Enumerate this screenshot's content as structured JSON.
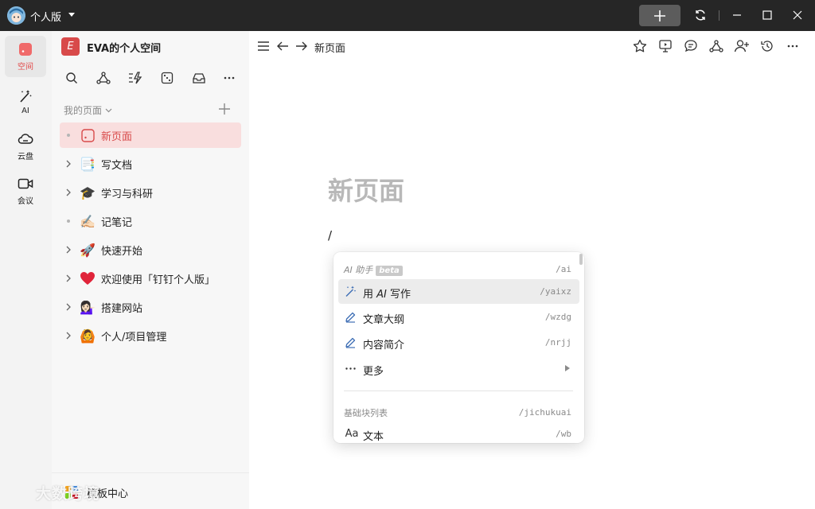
{
  "titlebar": {
    "app_title": "个人版"
  },
  "rail": {
    "items": [
      {
        "label": "空间",
        "icon": "space-icon"
      },
      {
        "label": "AI",
        "icon": "ai-wand-icon"
      },
      {
        "label": "云盘",
        "icon": "cloud-icon"
      },
      {
        "label": "会议",
        "icon": "video-icon"
      }
    ]
  },
  "sidebar": {
    "space_logo_letter": "E",
    "space_name": "EVA的个人空间",
    "section_label": "我的页面",
    "tree": [
      {
        "label": "新页面",
        "emoji": "",
        "has_children": false
      },
      {
        "label": "写文档",
        "emoji": "📑",
        "has_children": true
      },
      {
        "label": "学习与科研",
        "emoji": "🎓",
        "has_children": true
      },
      {
        "label": "记笔记",
        "emoji": "✍🏻",
        "has_children": false
      },
      {
        "label": "快速开始",
        "emoji": "🚀",
        "has_children": true
      },
      {
        "label": "欢迎使用「钉钉个人版」",
        "emoji": "❤️",
        "has_children": true
      },
      {
        "label": "搭建网站",
        "emoji": "💁🏻‍♀️",
        "has_children": true
      },
      {
        "label": "个人/项目管理",
        "emoji": "🙆",
        "has_children": true
      }
    ],
    "footer_label": "模板中心",
    "watermark": "大数跨境"
  },
  "main": {
    "breadcrumb": "新页面",
    "page_title": "新页面",
    "editor_text": "/"
  },
  "slash_menu": {
    "ai_group": {
      "label": "AI 助手",
      "badge": "beta",
      "shortcut": "/ai"
    },
    "items": [
      {
        "label_pre": "用 ",
        "label_em": "AI",
        "label_post": " 写作",
        "shortcut": "/yaixz",
        "icon": "ai-wand-icon"
      },
      {
        "label": "文章大纲",
        "shortcut": "/wzdg",
        "icon": "pen-icon"
      },
      {
        "label": "内容简介",
        "shortcut": "/nrjj",
        "icon": "pen-icon"
      },
      {
        "label": "更多",
        "shortcut": "",
        "icon": "more-icon"
      }
    ],
    "basic_group": {
      "label": "基础块列表",
      "shortcut": "/jichukuai"
    },
    "basic_items": [
      {
        "icon_text": "Aa",
        "label": "文本",
        "shortcut": "/wb"
      }
    ]
  },
  "colors": {
    "accent": "#d84a4a",
    "titlebar_bg": "#262626",
    "active_item_bg": "#f9dede"
  }
}
